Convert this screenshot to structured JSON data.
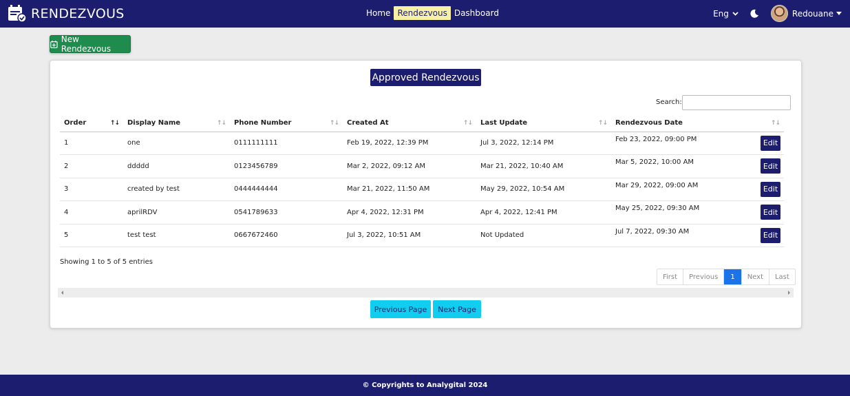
{
  "navbar": {
    "brand": "RENDEZVOUS",
    "links": [
      "Home",
      "Rendezvous",
      "Dashboard"
    ],
    "active_link": "Rendezvous",
    "language": "Eng",
    "user": "Redouane"
  },
  "toolbar": {
    "new_label": "New Rendezvous"
  },
  "card": {
    "title": "Approved Rendezvous",
    "search_label": "Search:",
    "search_value": "",
    "columns": [
      "Order",
      "Display Name",
      "Phone Number",
      "Created At",
      "Last Update",
      "Rendezvous Date"
    ],
    "rows": [
      {
        "order": "1",
        "name": "one",
        "phone": "0111111111",
        "created": "Feb 19, 2022, 12:39 PM",
        "updated": "Jul 3, 2022, 12:14 PM",
        "date": "Feb 23, 2022, 09:00 PM",
        "action": "Edit"
      },
      {
        "order": "2",
        "name": "ddddd",
        "phone": "0123456789",
        "created": "Mar 2, 2022, 09:12 AM",
        "updated": "Mar 21, 2022, 10:40 AM",
        "date": "Mar 5, 2022, 10:00 AM",
        "action": "Edit"
      },
      {
        "order": "3",
        "name": "created by test",
        "phone": "0444444444",
        "created": "Mar 21, 2022, 11:50 AM",
        "updated": "May 29, 2022, 10:54 AM",
        "date": "Mar 29, 2022, 09:00 AM",
        "action": "Edit"
      },
      {
        "order": "4",
        "name": "aprilRDV",
        "phone": "0541789633",
        "created": "Apr 4, 2022, 12:31 PM",
        "updated": "Apr 4, 2022, 12:41 PM",
        "date": "May 25, 2022, 09:30 AM",
        "action": "Edit"
      },
      {
        "order": "5",
        "name": "test test",
        "phone": "0667672460",
        "created": "Jul 3, 2022, 10:51 AM",
        "updated": "Not Updated",
        "date": "Jul 7, 2022, 09:30 AM",
        "action": "Edit"
      }
    ],
    "info": "Showing 1 to 5 of 5 entries",
    "pager": {
      "first": "First",
      "previous": "Previous",
      "current": "1",
      "next": "Next",
      "last": "Last"
    },
    "prev_page_label": "Previous Page",
    "next_page_label": "Next Page"
  },
  "footer": {
    "text": "© Copyrights to Analygital 2024"
  },
  "colors": {
    "navy": "#1c1d6e",
    "green": "#1e8c4c",
    "cyan": "#11cdef",
    "active_link_bg": "#f6f0a5",
    "pager_active": "#1a73e8"
  }
}
